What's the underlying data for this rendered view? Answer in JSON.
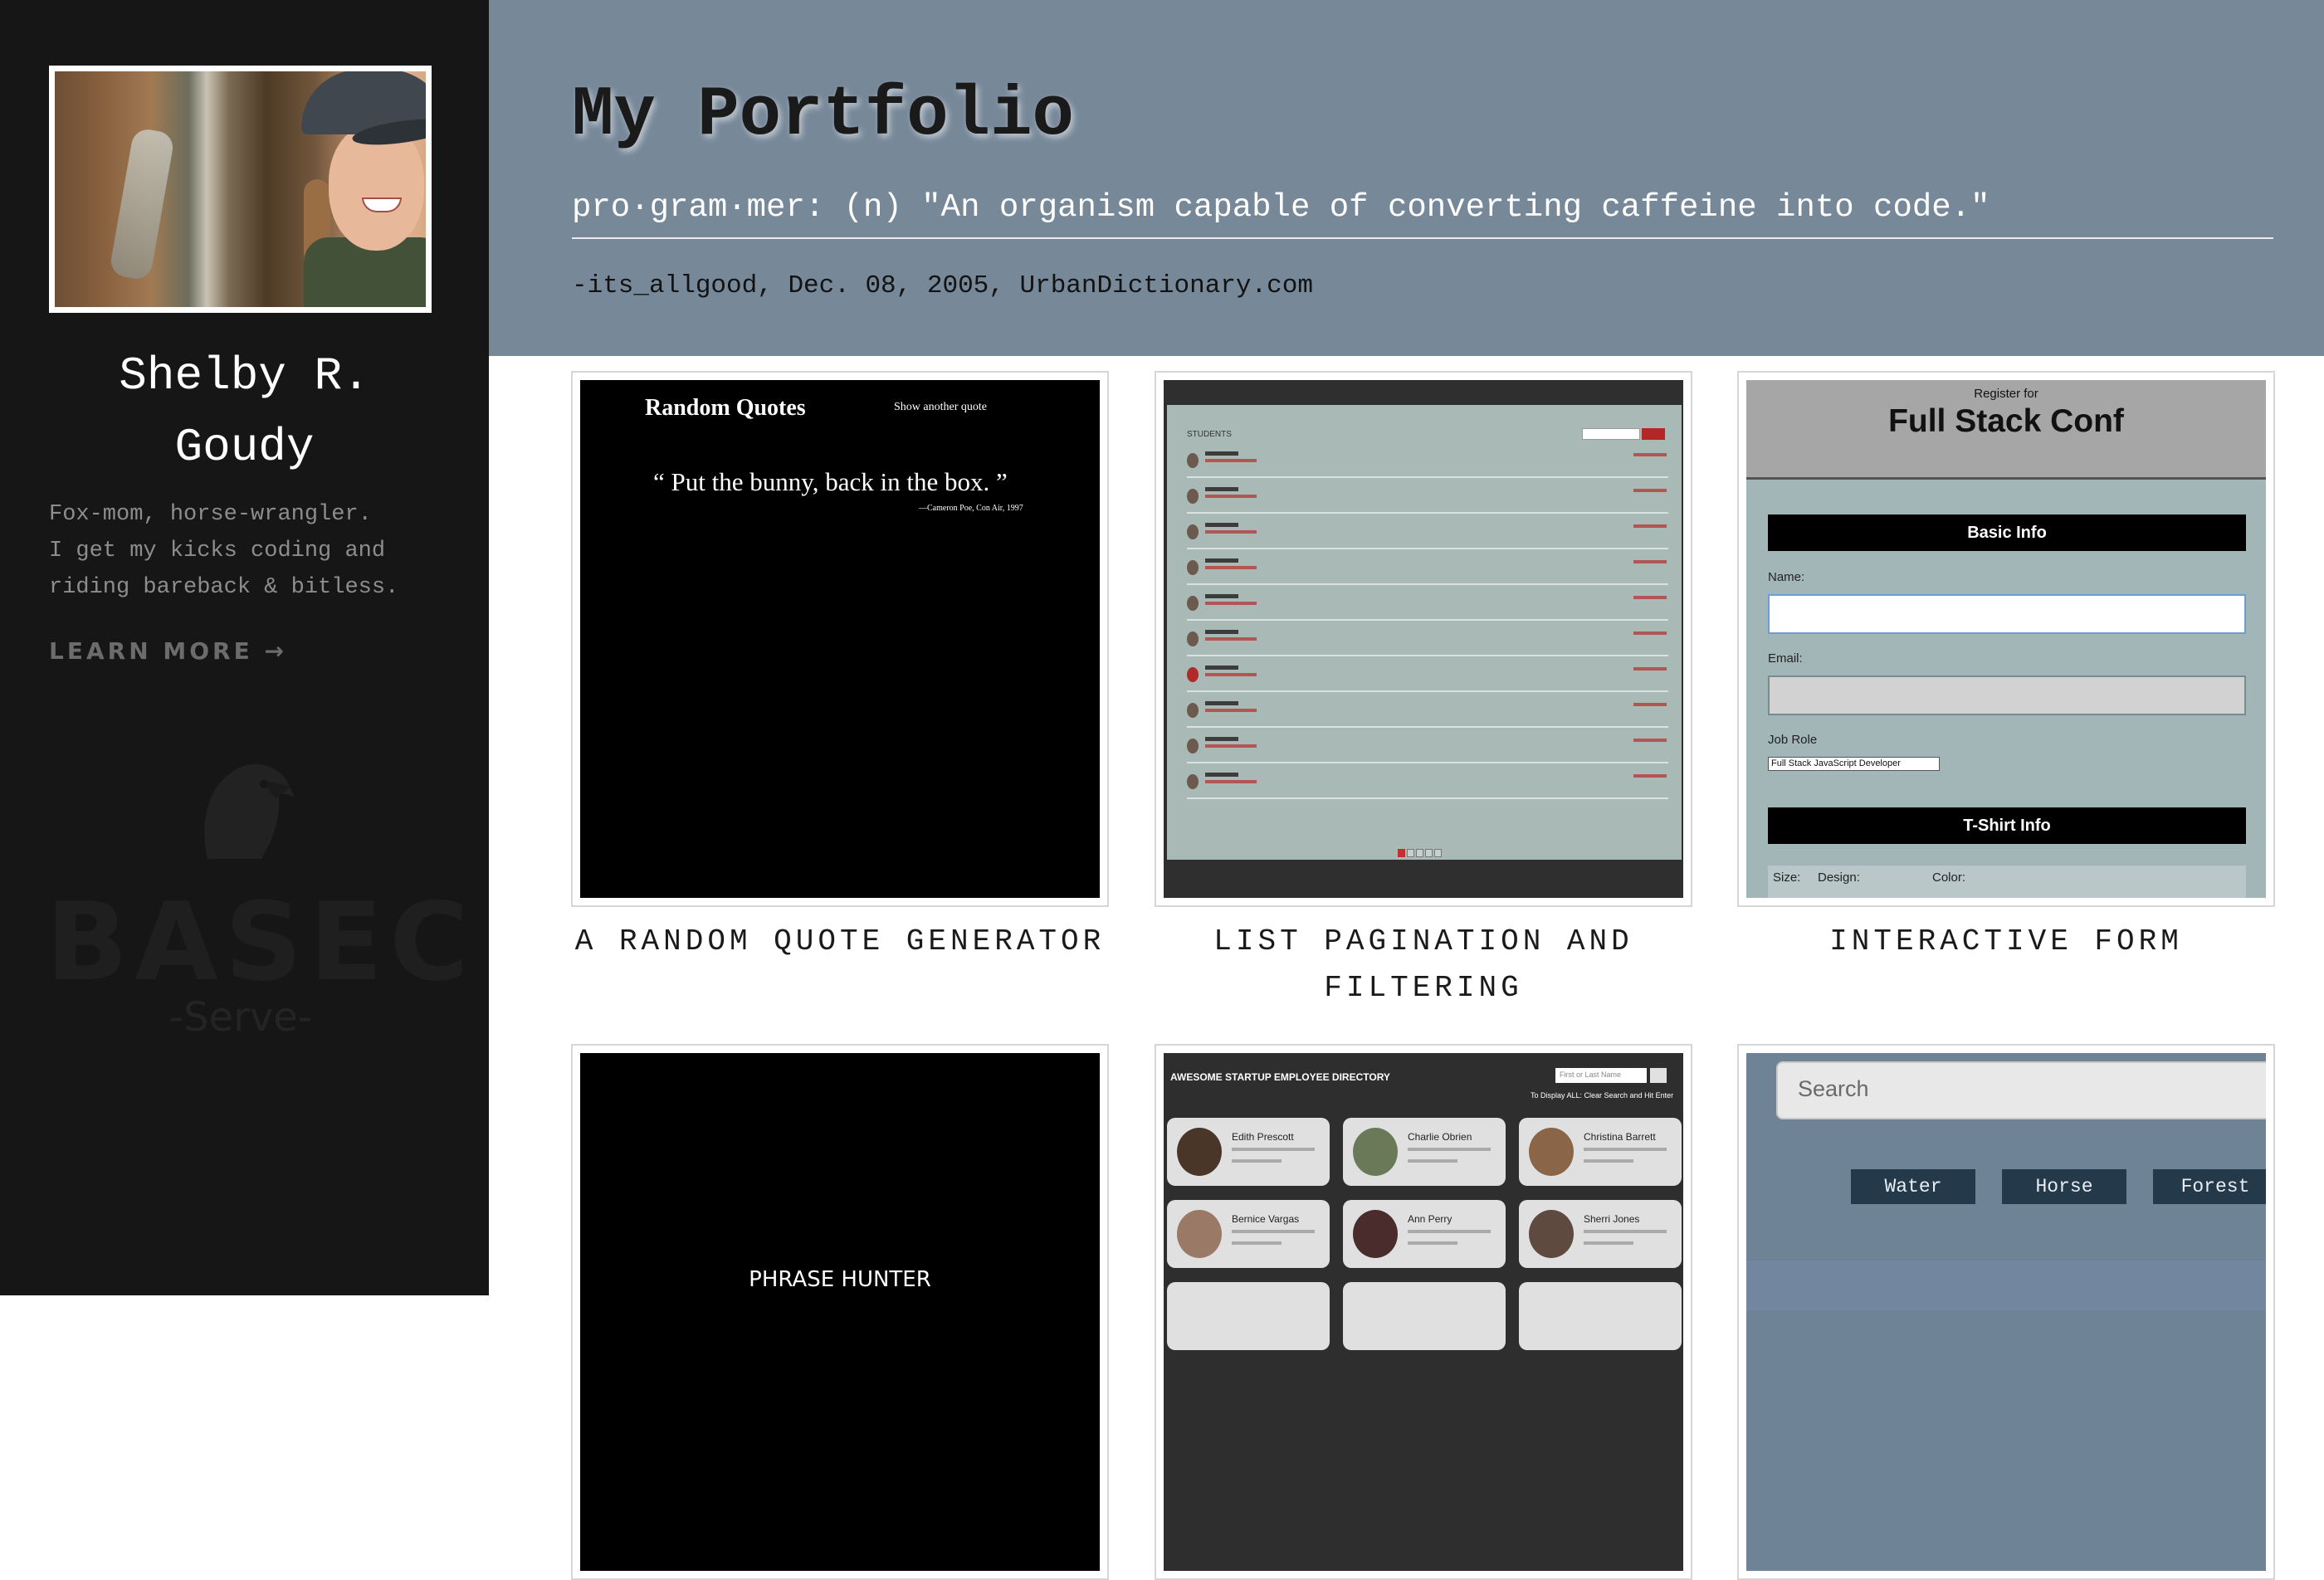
{
  "sidebar": {
    "name_line1": "Shelby R.",
    "name_line2": "Goudy",
    "bio": [
      "Fox-mom, horse-wrangler.",
      "I get my kicks coding and",
      "riding bareback & bitless."
    ],
    "learn_more": "LEARN MORE →",
    "logo_text": "BASEC",
    "logo_subtext": "-Serve-"
  },
  "header": {
    "title": "My Portfolio",
    "definition": "pro·gram·mer: (n) \"An organism capable of converting caffeine into code.\"",
    "attribution": "-its_allgood, Dec. 08, 2005, UrbanDictionary.com"
  },
  "projects": [
    {
      "caption": "A RANDOM QUOTE GENERATOR",
      "thumb": {
        "title": "Random Quotes",
        "button": "Show another quote",
        "quote": "“ Put the bunny, back in the box. ”",
        "source": "—Cameron Poe, Con Air, 1997"
      }
    },
    {
      "caption": "LIST PAGINATION AND FILTERING",
      "thumb": {
        "title": "STUDENTS"
      }
    },
    {
      "caption": "INTERACTIVE FORM",
      "thumb": {
        "register": "Register for",
        "conference": "Full Stack Conf",
        "basic_info": "Basic Info",
        "name_label": "Name:",
        "email_label": "Email:",
        "job_label": "Job Role",
        "job_value": "Full Stack JavaScript Developer",
        "tshirt": "T-Shirt Info",
        "size": "Size:",
        "design": "Design:",
        "color": "Color:"
      }
    },
    {
      "caption": "",
      "thumb": {
        "title": "PHRASE HUNTER"
      }
    },
    {
      "caption": "",
      "thumb": {
        "title": "AWESOME STARTUP EMPLOYEE DIRECTORY",
        "search_placeholder": "First or Last Name",
        "note": "To Display ALL: Clear Search and Hit Enter",
        "employees": [
          "Edith Prescott",
          "Charlie Obrien",
          "Christina Barrett",
          "Bernice Vargas",
          "Ann Perry",
          "Sherri Jones"
        ]
      }
    },
    {
      "caption": "",
      "thumb": {
        "search_placeholder": "Search",
        "buttons": [
          "Water",
          "Horse",
          "Forest"
        ]
      }
    }
  ],
  "colors": {
    "sidebar_bg": "#161616",
    "header_bg": "#778899",
    "accent_red": "#b52727"
  }
}
